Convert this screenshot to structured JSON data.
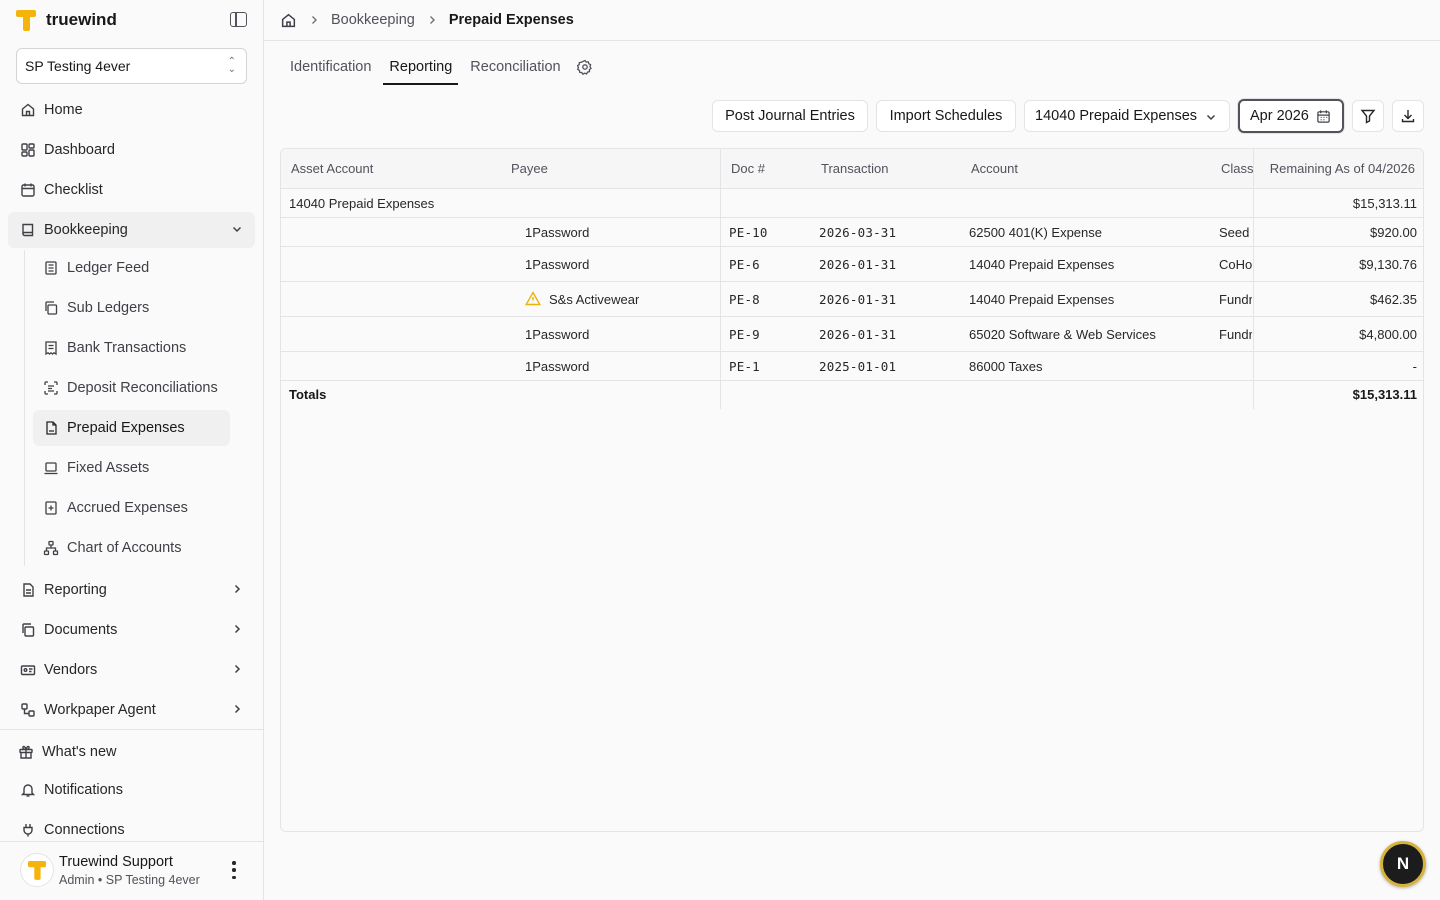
{
  "app": {
    "name": "truewind"
  },
  "org": {
    "name": "SP Testing 4ever"
  },
  "nav": {
    "home": "Home",
    "dashboard": "Dashboard",
    "checklist": "Checklist",
    "bookkeeping": "Bookkeeping",
    "sub": {
      "ledger_feed": "Ledger Feed",
      "sub_ledgers": "Sub Ledgers",
      "bank_transactions": "Bank Transactions",
      "deposit_reconciliations": "Deposit Reconciliations",
      "prepaid_expenses": "Prepaid Expenses",
      "fixed_assets": "Fixed Assets",
      "accrued_expenses": "Accrued Expenses",
      "chart_of_accounts": "Chart of Accounts"
    },
    "reporting": "Reporting",
    "documents": "Documents",
    "vendors": "Vendors",
    "workpaper_agent": "Workpaper Agent",
    "whats_new": "What's new",
    "notifications": "Notifications",
    "connections": "Connections"
  },
  "user": {
    "name": "Truewind Support",
    "role": "Admin • SP Testing 4ever"
  },
  "breadcrumb": {
    "section": "Bookkeeping",
    "current": "Prepaid Expenses"
  },
  "tabs": {
    "identification": "Identification",
    "reporting": "Reporting",
    "reconciliation": "Reconciliation"
  },
  "toolbar": {
    "post_journal": "Post Journal Entries",
    "import_schedules": "Import Schedules",
    "account_select": "14040 Prepaid Expenses",
    "period": "Apr 2026"
  },
  "table": {
    "headers": {
      "asset_account": "Asset Account",
      "payee": "Payee",
      "doc": "Doc #",
      "transaction": "Transaction",
      "account": "Account",
      "class": "Class",
      "remaining": "Remaining As of 04/2026"
    },
    "group": {
      "asset_account": "14040 Prepaid Expenses",
      "remaining": "$15,313.11"
    },
    "rows": [
      {
        "payee": "1Password",
        "doc": "PE-10",
        "transaction": "2026-03-31",
        "account": "62500 401(K) Expense",
        "class": "Seed Round",
        "remaining": "$920.00"
      },
      {
        "payee": "1Password",
        "doc": "PE-6",
        "transaction": "2026-01-31",
        "account": "14040 Prepaid Expenses",
        "class": "CoHost",
        "remaining": "$9,130.76"
      },
      {
        "payee": "S&s Activewear",
        "doc": "PE-8",
        "transaction": "2026-01-31",
        "account": "14040 Prepaid Expenses",
        "class": "Fundraising",
        "remaining": "$462.35"
      },
      {
        "payee": "1Password",
        "doc": "PE-9",
        "transaction": "2026-01-31",
        "account": "65020 Software & Web Services",
        "class": "Fundraising",
        "remaining": "$4,800.00"
      },
      {
        "payee": "1Password",
        "doc": "PE-1",
        "transaction": "2025-01-01",
        "account": "86000 Taxes",
        "class": "",
        "remaining": "-"
      }
    ],
    "totals": {
      "label": "Totals",
      "remaining": "$15,313.11"
    }
  },
  "fab": {
    "label": "N"
  },
  "colors": {
    "brand": "#f5b40b",
    "warning": "#eab308"
  }
}
